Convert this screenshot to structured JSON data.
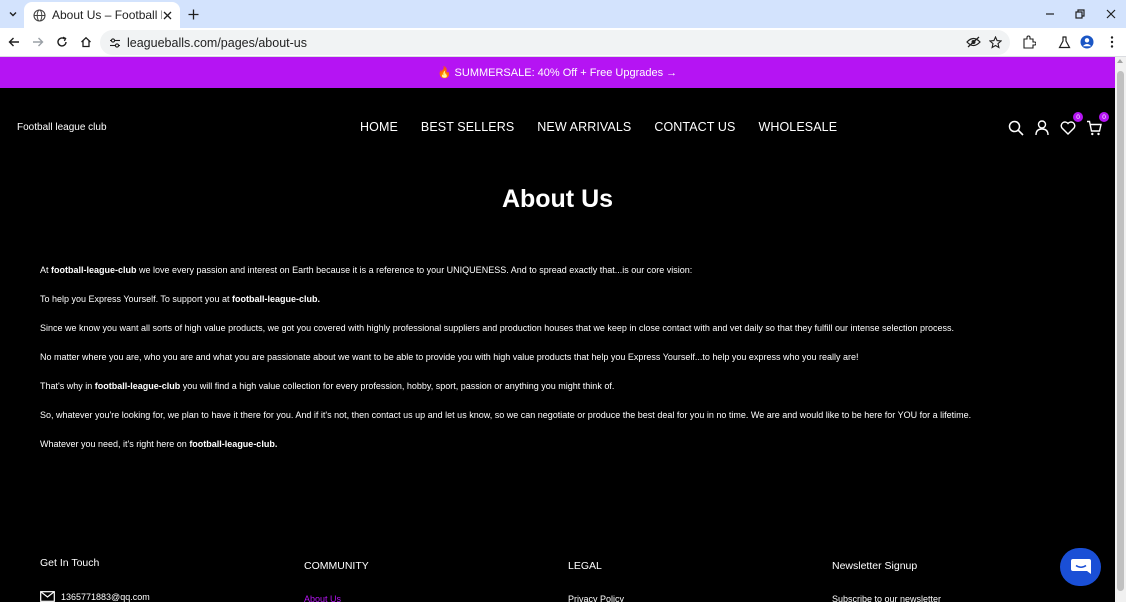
{
  "browser": {
    "tab_title": "About Us – Football league club",
    "url": "leagueballs.com/pages/about-us"
  },
  "announcement": "🔥 SUMMERSALE: 40% Off + Free Upgrades →",
  "header": {
    "logo_text": "Football league club",
    "nav": [
      "HOME",
      "BEST SELLERS",
      "NEW ARRIVALS",
      "CONTACT US",
      "WHOLESALE"
    ],
    "wishlist_count": "0",
    "cart_count": "0"
  },
  "page": {
    "title": "About Us",
    "paragraphs": [
      {
        "pre": "At ",
        "bold": "football-league-club",
        "post": " we love every passion and interest on Earth because it is a reference to your UNIQUENESS. And to spread exactly that...is our core vision:"
      },
      {
        "pre": "To help you Express Yourself. To support you at ",
        "bold": "football-league-club.",
        "post": ""
      },
      {
        "pre": "Since we know you want all sorts of high value products, we got you covered with highly professional suppliers and production houses that we keep in close contact with and vet daily so that they fulfill our intense selection process.",
        "bold": "",
        "post": ""
      },
      {
        "pre": "No matter where you are, who you are and what you are passionate about we want to be able to provide you with high value products that help you Express Yourself...to help you express who you really are!",
        "bold": "",
        "post": ""
      },
      {
        "pre": "That's why in ",
        "bold": "football-league-club",
        "post": " you will find a high value collection for every profession, hobby, sport, passion or anything you might think of."
      },
      {
        "pre": "So, whatever you're looking for, we plan to have it there for you. And if it's not, then contact us up and let us know, so we can negotiate or produce the best deal for you in no time. We are and would like to be here for YOU for a lifetime.",
        "bold": "",
        "post": ""
      },
      {
        "pre": "Whatever you need, it's right here on ",
        "bold": "football-league-club.",
        "post": ""
      }
    ]
  },
  "footer": {
    "get_in_touch": "Get In Touch",
    "email": "1365771883@qq.com",
    "community": "COMMUNITY",
    "community_link": "About Us",
    "legal": "LEGAL",
    "legal_link": "Privacy Policy",
    "newsletter": "Newsletter Signup",
    "newsletter_text": "Subscribe to our newsletter"
  },
  "colors": {
    "announcement_bg": "#b514f3",
    "chat_button": "#1a4fd6"
  }
}
